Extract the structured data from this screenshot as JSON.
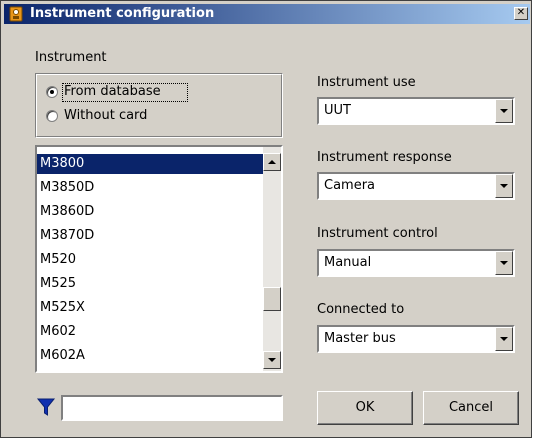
{
  "window": {
    "title": "Instrument configuration"
  },
  "instrument": {
    "section_label": "Instrument",
    "source_options": [
      {
        "label": "From database",
        "checked": true
      },
      {
        "label": "Without card",
        "checked": false
      }
    ],
    "list": {
      "items": [
        "M3800",
        "M3850D",
        "M3860D",
        "M3870D",
        "M520",
        "M525",
        "M525X",
        "M602",
        "M602A"
      ],
      "selected": "M3800"
    }
  },
  "settings": {
    "instrument_use": {
      "label": "Instrument use",
      "value": "UUT"
    },
    "instrument_response": {
      "label": "Instrument response",
      "value": "Camera"
    },
    "instrument_control": {
      "label": "Instrument control",
      "value": "Manual"
    },
    "connected_to": {
      "label": "Connected to",
      "value": "Master bus"
    }
  },
  "filter": {
    "value": ""
  },
  "buttons": {
    "ok": "OK",
    "cancel": "Cancel"
  },
  "colors": {
    "title_bar": "#0a246a",
    "selection": "#0a246a",
    "filter_icon": "#1030b0",
    "dialog_face": "#d4d0c8"
  }
}
